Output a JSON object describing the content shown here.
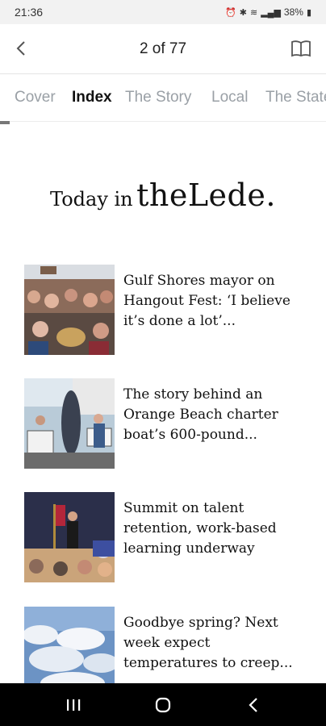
{
  "status": {
    "time": "21:36",
    "battery": "38%"
  },
  "appbar": {
    "pager": "2 of 77"
  },
  "tabs": [
    "Cover",
    "Index",
    "The Story",
    "Local",
    "The State"
  ],
  "header": {
    "pre": "Today in",
    "brand": "theLede."
  },
  "articles": [
    {
      "headline": "Gulf Shores mayor on Hangout Fest: ‘I believe it’s done a lot’..."
    },
    {
      "headline": "The story behind an Orange Beach charter boat’s 600-pound..."
    },
    {
      "headline": "Summit on talent retention, work-based learning underway"
    },
    {
      "headline": "Goodbye spring? Next week expect temperatures to creep..."
    }
  ],
  "icons": {
    "back": "chevron-left-icon",
    "book": "book-icon",
    "recent_apps": "recent-apps-icon",
    "home": "home-icon",
    "nav_back": "back-icon"
  }
}
